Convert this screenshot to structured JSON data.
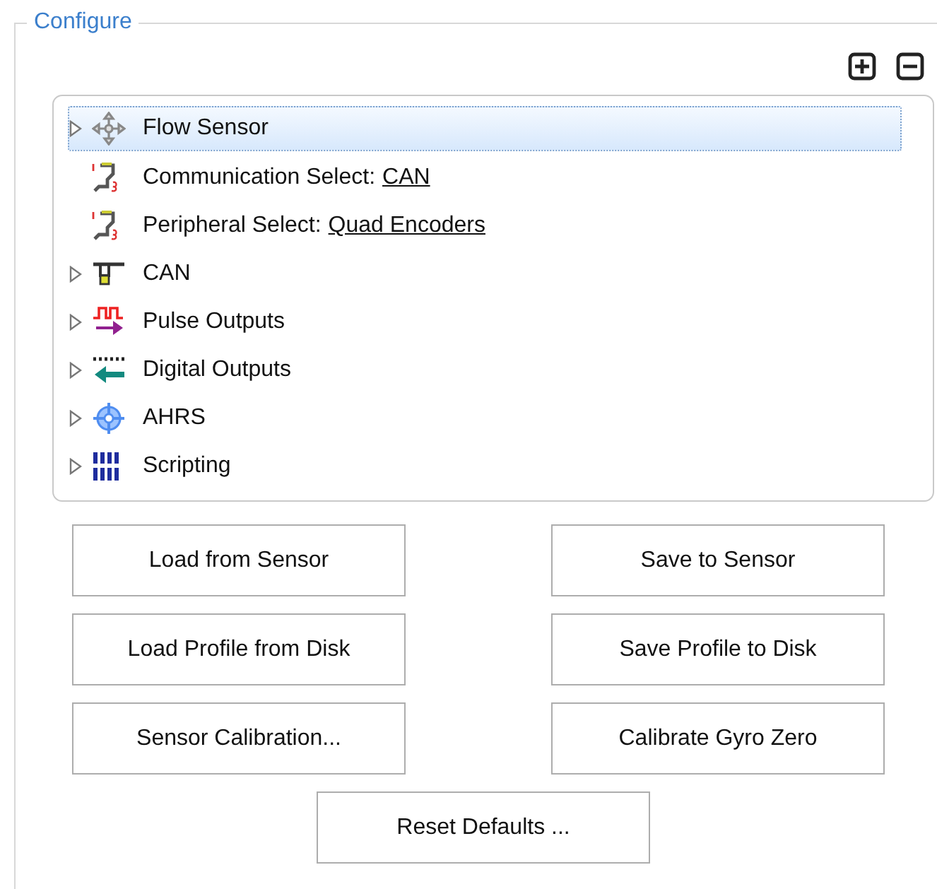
{
  "group": {
    "title": "Configure"
  },
  "tree": {
    "items": [
      {
        "kind": "node",
        "label": "Flow Sensor",
        "expanded": false,
        "selected": true
      },
      {
        "kind": "setting",
        "label": "Communication Select:",
        "value": "CAN",
        "selected": false
      },
      {
        "kind": "setting",
        "label": "Peripheral Select:",
        "value": "Quad Encoders",
        "selected": false
      },
      {
        "kind": "node",
        "label": "CAN",
        "expanded": false,
        "selected": false
      },
      {
        "kind": "node",
        "label": "Pulse Outputs",
        "expanded": false,
        "selected": false
      },
      {
        "kind": "node",
        "label": "Digital Outputs",
        "expanded": false,
        "selected": false
      },
      {
        "kind": "node",
        "label": "AHRS",
        "expanded": false,
        "selected": false
      },
      {
        "kind": "node",
        "label": "Scripting",
        "expanded": false,
        "selected": false
      }
    ]
  },
  "buttons": [
    "Load from Sensor",
    "Save to Sensor",
    "Load Profile from Disk",
    "Save Profile to Disk",
    "Sensor Calibration...",
    "Calibrate Gyro Zero"
  ],
  "reset_button": "Reset Defaults ..."
}
